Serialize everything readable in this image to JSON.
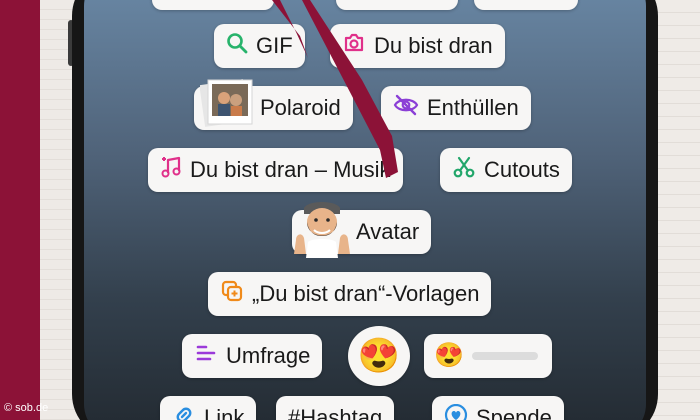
{
  "colors": {
    "page_accent": "#8c1237",
    "chip_background": "#f7f6f5",
    "gif_icon": "#27b36b",
    "du_bist_dran_icon": "#e0308a",
    "reveal_icon": "#8b3fd6",
    "music_icon": "#e0308a",
    "cutouts_icon": "#22a66a",
    "templates_icon": "#f08a1a",
    "poll_icon": "#9b3ad9",
    "link_icon": "#2a8ee0",
    "hashtag_icon": "#9b3ad9",
    "donation_icon": "#2a8ee0",
    "scribble": "#8c1237"
  },
  "stickers": {
    "gif": {
      "label": "GIF",
      "icon": "search-icon"
    },
    "du_bist_dran": {
      "label": "Du bist dran",
      "icon": "camera-icon"
    },
    "polaroid": {
      "label": "Polaroid",
      "icon": "polaroid-photo-icon"
    },
    "enthuellen": {
      "label": "Enthüllen",
      "icon": "eye-off-icon"
    },
    "du_bist_dran_musik": {
      "label": "Du bist dran – Musik",
      "icon": "music-note-icon"
    },
    "cutouts": {
      "label": "Cutouts",
      "icon": "scissors-icon"
    },
    "avatar": {
      "label": "Avatar",
      "icon": "avatar-icon"
    },
    "vorlagen": {
      "label": "„Du bist dran“-Vorlagen",
      "icon": "template-stack-icon"
    },
    "umfrage": {
      "label": "Umfrage",
      "icon": "poll-lines-icon"
    },
    "emoji_reaction": {
      "emoji": "😍"
    },
    "emoji_slider": {
      "emoji": "😍",
      "level": 0
    },
    "link": {
      "label": "Link",
      "icon": "link-icon"
    },
    "hashtag": {
      "label": "#Hashtag"
    },
    "spende": {
      "label": "Spende",
      "icon": "heart-icon"
    }
  },
  "watermark": "© sob.de"
}
